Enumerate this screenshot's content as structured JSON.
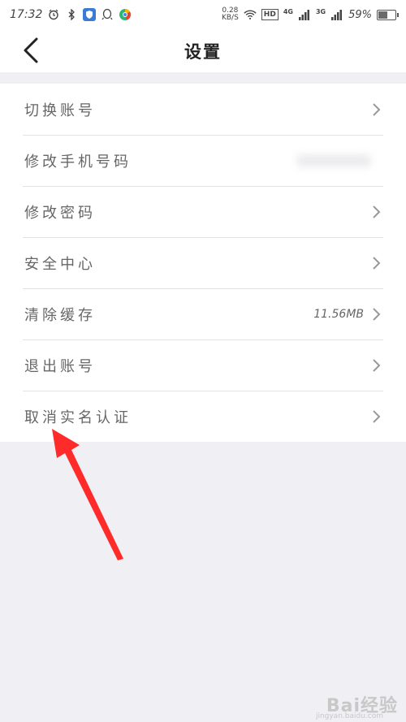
{
  "status_bar": {
    "time": "17:32",
    "speed_value": "0.28",
    "speed_unit": "KB/S",
    "hd": "HD",
    "net1": "4G",
    "net2": "3G",
    "battery_pct": "59%",
    "battery_level": 0.59
  },
  "header": {
    "title": "设置",
    "back_icon": "chevron-left-icon"
  },
  "settings": {
    "items": [
      {
        "label": "切换账号",
        "value": ""
      },
      {
        "label": "修改手机号码",
        "value": ""
      },
      {
        "label": "修改密码",
        "value": ""
      },
      {
        "label": "安全中心",
        "value": ""
      },
      {
        "label": "清除缓存",
        "value": "11.56MB"
      },
      {
        "label": "退出账号",
        "value": ""
      },
      {
        "label": "取消实名认证",
        "value": ""
      }
    ]
  },
  "annotation": {
    "color": "#ff2a2a"
  },
  "watermark": {
    "text": "Bai经验",
    "sub": "jingyan.baidu.com"
  }
}
